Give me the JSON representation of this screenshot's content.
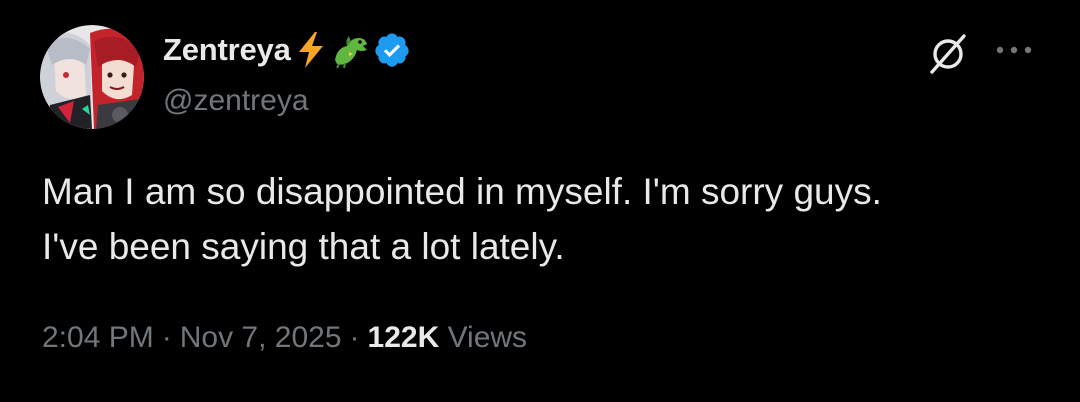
{
  "tweet": {
    "author": {
      "display_name": "Zentreya",
      "emoji_1": "lightning-bolt-icon",
      "emoji_2": "dragon-icon",
      "handle": "@zentreya",
      "verified": true,
      "verified_color": "#1d9bf0"
    },
    "text": "Man I am so disappointed in myself. I'm sorry guys.\nI've been saying that a lot lately.",
    "time": "2:04 PM",
    "separator": "·",
    "date": "Nov 7, 2025",
    "views_count": "122K",
    "views_label": "Views",
    "icons": {
      "grok": "grok-icon",
      "more": "more-horizontal-icon"
    }
  },
  "theme": {
    "background": "#000000",
    "text_primary": "#e7e9ea",
    "text_secondary": "#71767b"
  }
}
